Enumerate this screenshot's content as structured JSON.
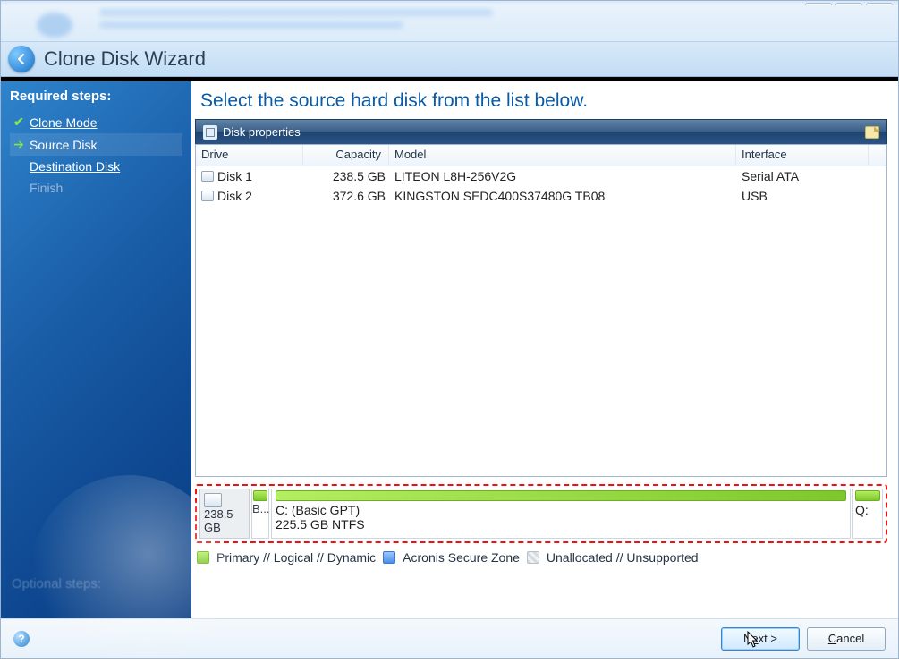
{
  "window": {
    "title": "Clone Disk Wizard",
    "min_label": "_",
    "max_label": "▢",
    "close_label": "✕"
  },
  "sidebar": {
    "heading": "Required steps:",
    "items": [
      {
        "label": "Clone Mode",
        "icon": "check",
        "link": true,
        "dim": false,
        "active": false
      },
      {
        "label": "Source Disk",
        "icon": "arrow",
        "link": false,
        "dim": false,
        "active": true
      },
      {
        "label": "Destination Disk",
        "icon": "",
        "link": true,
        "dim": false,
        "active": false
      },
      {
        "label": "Finish",
        "icon": "",
        "link": false,
        "dim": true,
        "active": false
      }
    ],
    "optional_heading": "Optional steps:"
  },
  "main": {
    "title": "Select the source hard disk from the list below.",
    "panel_heading": "Disk properties"
  },
  "table": {
    "headers": {
      "drive": "Drive",
      "capacity": "Capacity",
      "model": "Model",
      "interface": "Interface"
    },
    "rows": [
      {
        "drive": "Disk 1",
        "capacity": "238.5 GB",
        "model": "LITEON L8H-256V2G",
        "interface": "Serial ATA"
      },
      {
        "drive": "Disk 2",
        "capacity": "372.6 GB",
        "model": "KINGSTON SEDC400S37480G TB08",
        "interface": "USB"
      }
    ]
  },
  "partition": {
    "size_label": "238.5 GB",
    "boot_short": "B...",
    "c_label": "C: (Basic GPT)",
    "c_size": "225.5 GB  NTFS",
    "q_label": "Q:"
  },
  "legend": {
    "primary": "Primary // Logical // Dynamic",
    "asz": "Acronis Secure Zone",
    "unalloc": "Unallocated // Unsupported"
  },
  "buttons": {
    "next": "Next >",
    "cancel": "Cancel",
    "help": "?"
  }
}
